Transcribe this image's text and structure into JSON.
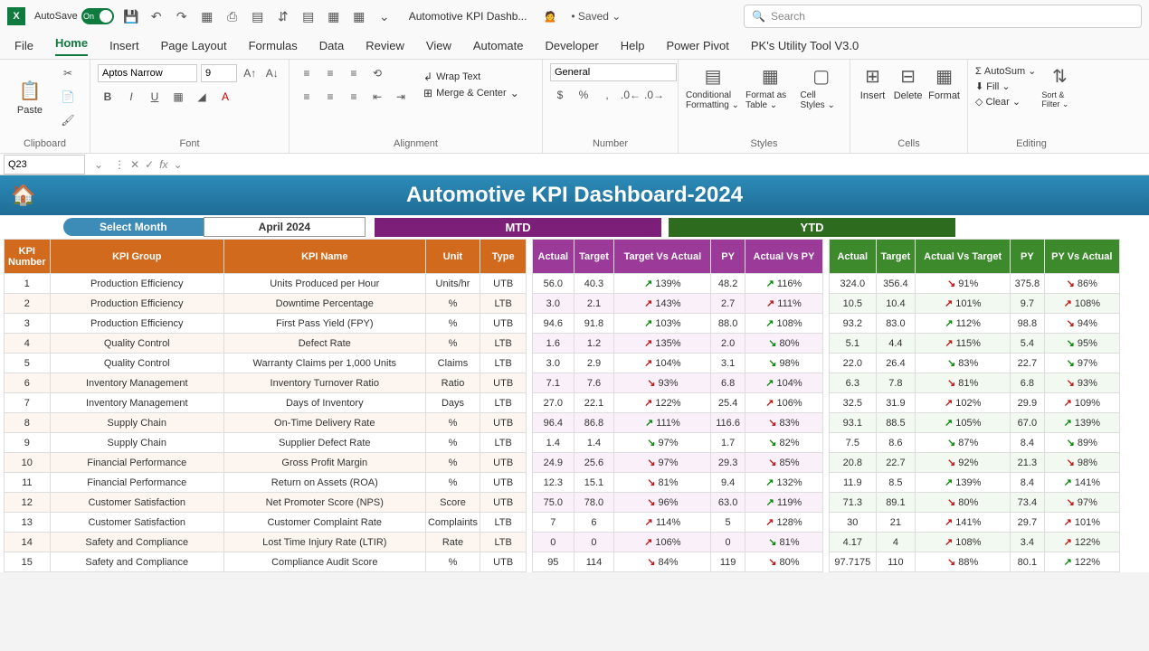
{
  "titlebar": {
    "autosave": "AutoSave",
    "autosave_state": "On",
    "doc": "Automotive KPI Dashb...",
    "saved": "• Saved ⌄",
    "search_ph": "Search"
  },
  "tabs": [
    "File",
    "Home",
    "Insert",
    "Page Layout",
    "Formulas",
    "Data",
    "Review",
    "View",
    "Automate",
    "Developer",
    "Help",
    "Power Pivot",
    "PK's Utility Tool V3.0"
  ],
  "ribbon": {
    "clipboard": "Clipboard",
    "paste": "Paste",
    "font": "Font",
    "font_name": "Aptos Narrow",
    "font_size": "9",
    "alignment": "Alignment",
    "wrap": "Wrap Text",
    "merge": "Merge & Center",
    "number": "Number",
    "numfmt": "General",
    "styles": "Styles",
    "cf": "Conditional Formatting ⌄",
    "fat": "Format as Table ⌄",
    "cs": "Cell Styles ⌄",
    "cells": "Cells",
    "ins": "Insert",
    "del": "Delete",
    "fmt": "Format",
    "editing": "Editing",
    "autosum": "AutoSum",
    "fill": "Fill ⌄",
    "clear": "Clear ⌄",
    "sort": "Sort & Filter ⌄"
  },
  "namebox": "Q23",
  "dash_title": "Automotive KPI Dashboard-2024",
  "select_month": "Select Month",
  "month": "April 2024",
  "mtd": "MTD",
  "ytd": "YTD",
  "cols_left": [
    "KPI Number",
    "KPI Group",
    "KPI Name",
    "Unit",
    "Type"
  ],
  "cols_mtd": [
    "Actual",
    "Target",
    "Target Vs Actual",
    "PY",
    "Actual Vs PY"
  ],
  "cols_ytd": [
    "Actual",
    "Target",
    "Actual Vs Target",
    "PY",
    "PY Vs Actual"
  ],
  "rows": [
    {
      "n": "1",
      "g": "Production Efficiency",
      "k": "Units Produced per Hour",
      "u": "Units/hr",
      "t": "UTB",
      "ma": "56.0",
      "mt": "40.3",
      "mtv": "139%",
      "mtd": "u",
      "mp": "48.2",
      "mpv": "116%",
      "mpd": "u",
      "ya": "324.0",
      "yt": "356.4",
      "ytv": "91%",
      "ytd": "d",
      "yp": "375.8",
      "ypv": "86%",
      "ypd": "d"
    },
    {
      "n": "2",
      "g": "Production Efficiency",
      "k": "Downtime Percentage",
      "u": "%",
      "t": "LTB",
      "ma": "3.0",
      "mt": "2.1",
      "mtv": "143%",
      "mtd": "r",
      "mp": "2.7",
      "mpv": "111%",
      "mpd": "r",
      "ya": "10.5",
      "yt": "10.4",
      "ytv": "101%",
      "ytd": "r",
      "yp": "9.7",
      "ypv": "108%",
      "ypd": "r"
    },
    {
      "n": "3",
      "g": "Production Efficiency",
      "k": "First Pass Yield (FPY)",
      "u": "%",
      "t": "UTB",
      "ma": "94.6",
      "mt": "91.8",
      "mtv": "103%",
      "mtd": "u",
      "mp": "88.0",
      "mpv": "108%",
      "mpd": "u",
      "ya": "93.2",
      "yt": "83.0",
      "ytv": "112%",
      "ytd": "u",
      "yp": "98.8",
      "ypv": "94%",
      "ypd": "d"
    },
    {
      "n": "4",
      "g": "Quality Control",
      "k": "Defect Rate",
      "u": "%",
      "t": "LTB",
      "ma": "1.6",
      "mt": "1.2",
      "mtv": "135%",
      "mtd": "r",
      "mp": "2.0",
      "mpv": "80%",
      "mpd": "g",
      "ya": "5.1",
      "yt": "4.4",
      "ytv": "115%",
      "ytd": "r",
      "yp": "5.4",
      "ypv": "95%",
      "ypd": "g"
    },
    {
      "n": "5",
      "g": "Quality Control",
      "k": "Warranty Claims per 1,000 Units",
      "u": "Claims",
      "t": "LTB",
      "ma": "3.0",
      "mt": "2.9",
      "mtv": "104%",
      "mtd": "r",
      "mp": "3.1",
      "mpv": "98%",
      "mpd": "g",
      "ya": "22.0",
      "yt": "26.4",
      "ytv": "83%",
      "ytd": "g",
      "yp": "22.7",
      "ypv": "97%",
      "ypd": "g"
    },
    {
      "n": "6",
      "g": "Inventory Management",
      "k": "Inventory Turnover Ratio",
      "u": "Ratio",
      "t": "UTB",
      "ma": "7.1",
      "mt": "7.6",
      "mtv": "93%",
      "mtd": "d",
      "mp": "6.8",
      "mpv": "104%",
      "mpd": "u",
      "ya": "6.3",
      "yt": "7.8",
      "ytv": "81%",
      "ytd": "d",
      "yp": "6.8",
      "ypv": "93%",
      "ypd": "d"
    },
    {
      "n": "7",
      "g": "Inventory Management",
      "k": "Days of Inventory",
      "u": "Days",
      "t": "LTB",
      "ma": "27.0",
      "mt": "22.1",
      "mtv": "122%",
      "mtd": "r",
      "mp": "25.4",
      "mpv": "106%",
      "mpd": "r",
      "ya": "32.5",
      "yt": "31.9",
      "ytv": "102%",
      "ytd": "r",
      "yp": "29.9",
      "ypv": "109%",
      "ypd": "r"
    },
    {
      "n": "8",
      "g": "Supply Chain",
      "k": "On-Time Delivery Rate",
      "u": "%",
      "t": "UTB",
      "ma": "96.4",
      "mt": "86.8",
      "mtv": "111%",
      "mtd": "u",
      "mp": "116.6",
      "mpv": "83%",
      "mpd": "d",
      "ya": "93.1",
      "yt": "88.5",
      "ytv": "105%",
      "ytd": "u",
      "yp": "67.0",
      "ypv": "139%",
      "ypd": "u"
    },
    {
      "n": "9",
      "g": "Supply Chain",
      "k": "Supplier Defect Rate",
      "u": "%",
      "t": "LTB",
      "ma": "1.4",
      "mt": "1.4",
      "mtv": "97%",
      "mtd": "g",
      "mp": "1.7",
      "mpv": "82%",
      "mpd": "g",
      "ya": "7.5",
      "yt": "8.6",
      "ytv": "87%",
      "ytd": "g",
      "yp": "8.4",
      "ypv": "89%",
      "ypd": "g"
    },
    {
      "n": "10",
      "g": "Financial Performance",
      "k": "Gross Profit Margin",
      "u": "%",
      "t": "UTB",
      "ma": "24.9",
      "mt": "25.6",
      "mtv": "97%",
      "mtd": "d",
      "mp": "29.3",
      "mpv": "85%",
      "mpd": "d",
      "ya": "20.8",
      "yt": "22.7",
      "ytv": "92%",
      "ytd": "d",
      "yp": "21.3",
      "ypv": "98%",
      "ypd": "d"
    },
    {
      "n": "11",
      "g": "Financial Performance",
      "k": "Return on Assets (ROA)",
      "u": "%",
      "t": "UTB",
      "ma": "12.3",
      "mt": "15.1",
      "mtv": "81%",
      "mtd": "d",
      "mp": "9.4",
      "mpv": "132%",
      "mpd": "u",
      "ya": "11.9",
      "yt": "8.5",
      "ytv": "139%",
      "ytd": "u",
      "yp": "8.4",
      "ypv": "141%",
      "ypd": "u"
    },
    {
      "n": "12",
      "g": "Customer Satisfaction",
      "k": "Net Promoter Score (NPS)",
      "u": "Score",
      "t": "UTB",
      "ma": "75.0",
      "mt": "78.0",
      "mtv": "96%",
      "mtd": "d",
      "mp": "63.0",
      "mpv": "119%",
      "mpd": "u",
      "ya": "71.3",
      "yt": "89.1",
      "ytv": "80%",
      "ytd": "d",
      "yp": "73.4",
      "ypv": "97%",
      "ypd": "d"
    },
    {
      "n": "13",
      "g": "Customer Satisfaction",
      "k": "Customer Complaint Rate",
      "u": "Complaints",
      "t": "LTB",
      "ma": "7",
      "mt": "6",
      "mtv": "114%",
      "mtd": "r",
      "mp": "5",
      "mpv": "128%",
      "mpd": "r",
      "ya": "30",
      "yt": "21",
      "ytv": "141%",
      "ytd": "r",
      "yp": "29.7",
      "ypv": "101%",
      "ypd": "r"
    },
    {
      "n": "14",
      "g": "Safety and Compliance",
      "k": "Lost Time Injury Rate (LTIR)",
      "u": "Rate",
      "t": "LTB",
      "ma": "0",
      "mt": "0",
      "mtv": "106%",
      "mtd": "r",
      "mp": "0",
      "mpv": "81%",
      "mpd": "g",
      "ya": "4.17",
      "yt": "4",
      "ytv": "108%",
      "ytd": "r",
      "yp": "3.4",
      "ypv": "122%",
      "ypd": "r"
    },
    {
      "n": "15",
      "g": "Safety and Compliance",
      "k": "Compliance Audit Score",
      "u": "%",
      "t": "UTB",
      "ma": "95",
      "mt": "114",
      "mtv": "84%",
      "mtd": "d",
      "mp": "119",
      "mpv": "80%",
      "mpd": "d",
      "ya": "97.7175",
      "yt": "110",
      "ytv": "88%",
      "ytd": "d",
      "yp": "80.1",
      "ypv": "122%",
      "ypd": "u"
    }
  ]
}
